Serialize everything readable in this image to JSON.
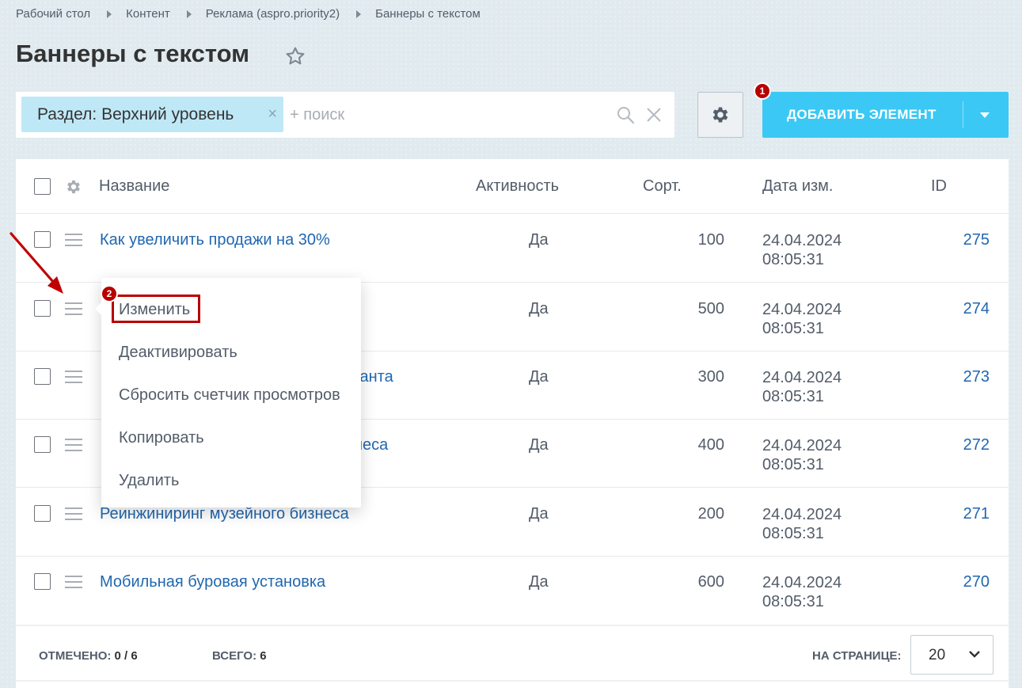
{
  "breadcrumb": [
    "Рабочий стол",
    "Контент",
    "Реклама (aspro.priority2)",
    "Баннеры с текстом"
  ],
  "page": {
    "title": "Баннеры с текстом"
  },
  "filter": {
    "chip_label": "Раздел: Верхний уровень",
    "chip_close": "×",
    "search_placeholder": "+ поиск"
  },
  "toolbar": {
    "add_label": "ДОБАВИТЬ ЭЛЕМЕНТ"
  },
  "markers": {
    "add": "1",
    "menu": "2"
  },
  "table": {
    "headers": {
      "name": "Название",
      "active": "Активность",
      "sort": "Сорт.",
      "date": "Дата изм.",
      "id": "ID"
    },
    "rows": [
      {
        "name": "Как увеличить продажи на 30%",
        "active": "Да",
        "sort": "100",
        "date1": "24.04.2024",
        "date2": "08:05:31",
        "id": "275"
      },
      {
        "name": "",
        "active": "Да",
        "sort": "500",
        "date1": "24.04.2024",
        "date2": "08:05:31",
        "id": "274"
      },
      {
        "name": "льтанта",
        "active": "Да",
        "sort": "300",
        "date1": "24.04.2024",
        "date2": "08:05:31",
        "id": "273"
      },
      {
        "name": "неса",
        "active": "Да",
        "sort": "400",
        "date1": "24.04.2024",
        "date2": "08:05:31",
        "id": "272"
      },
      {
        "name": "Реинжиниринг музейного бизнеса",
        "active": "Да",
        "sort": "200",
        "date1": "24.04.2024",
        "date2": "08:05:31",
        "id": "271"
      },
      {
        "name": "Мобильная буровая установка",
        "active": "Да",
        "sort": "600",
        "date1": "24.04.2024",
        "date2": "08:05:31",
        "id": "270"
      }
    ]
  },
  "footer": {
    "selected_label": "ОТМЕЧЕНО:",
    "selected_value": "0 / 6",
    "total_label": "ВСЕГО:",
    "total_value": "6",
    "per_page_label": "НА СТРАНИЦЕ:",
    "per_page_value": "20"
  },
  "context_menu": {
    "items": [
      "Изменить",
      "Деактивировать",
      "Сбросить счетчик просмотров",
      "Копировать",
      "Удалить"
    ]
  },
  "colors": {
    "accent": "#3bc8f5",
    "link": "#2067b0",
    "marker": "#b80000",
    "chip": "#bfe8f7"
  }
}
